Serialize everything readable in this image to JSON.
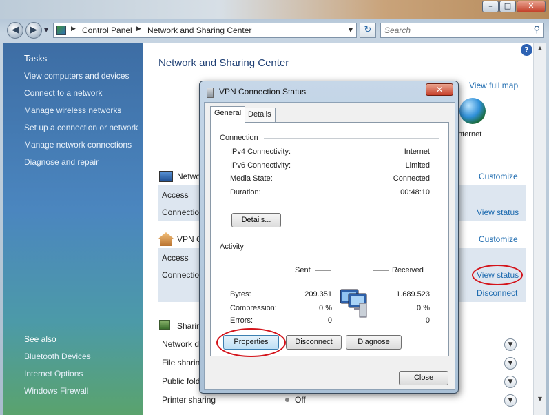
{
  "window": {
    "controls": [
      "–",
      "□",
      "✕"
    ]
  },
  "address": {
    "crumbs": [
      "Control Panel",
      "Network and Sharing Center"
    ],
    "search_placeholder": "Search"
  },
  "tasks": {
    "heading": "Tasks",
    "items": [
      "View computers and devices",
      "Connect to a network",
      "Manage wireless networks",
      "Set up a connection or network",
      "Manage network connections",
      "Diagnose and repair"
    ]
  },
  "see_also": {
    "heading": "See also",
    "items": [
      "Bluetooth Devices",
      "Internet Options",
      "Windows Firewall"
    ]
  },
  "main": {
    "title": "Network and Sharing Center",
    "view_full_map": "View full map",
    "internet_label": "nternet",
    "network1": {
      "name": "Netwo",
      "access": "Access",
      "connection": "Connection",
      "customize": "Customize",
      "view_status": "View status"
    },
    "network2": {
      "name": "VPN C",
      "access": "Access",
      "connection": "Connection",
      "customize": "Customize",
      "view_status": "View status",
      "disconnect": "Disconnect"
    },
    "sharing": {
      "heading": "Sharin",
      "rows": [
        {
          "label": "Network d"
        },
        {
          "label": "File sharin"
        },
        {
          "label": "Public fold"
        },
        {
          "label": "Printer sharing",
          "value": "Off"
        }
      ]
    }
  },
  "dialog": {
    "title": "VPN Connection Status",
    "tabs": [
      "General",
      "Details"
    ],
    "connection": {
      "heading": "Connection",
      "rows": [
        {
          "key": "IPv4 Connectivity:",
          "value": "Internet"
        },
        {
          "key": "IPv6 Connectivity:",
          "value": "Limited"
        },
        {
          "key": "Media State:",
          "value": "Connected"
        },
        {
          "key": "Duration:",
          "value": "00:48:10"
        }
      ],
      "details_button": "Details..."
    },
    "activity": {
      "heading": "Activity",
      "sent_label": "Sent",
      "received_label": "Received",
      "rows": [
        {
          "key": "Bytes:",
          "sent": "209.351",
          "received": "1.689.523"
        },
        {
          "key": "Compression:",
          "sent": "0 %",
          "received": "0 %"
        },
        {
          "key": "Errors:",
          "sent": "0",
          "received": "0"
        }
      ]
    },
    "buttons": {
      "properties": "Properties",
      "disconnect": "Disconnect",
      "diagnose": "Diagnose",
      "close": "Close"
    }
  },
  "colors": {
    "link": "#1f6cb0",
    "highlight_ring": "#d4141b",
    "title_blue": "#1e3f74"
  }
}
